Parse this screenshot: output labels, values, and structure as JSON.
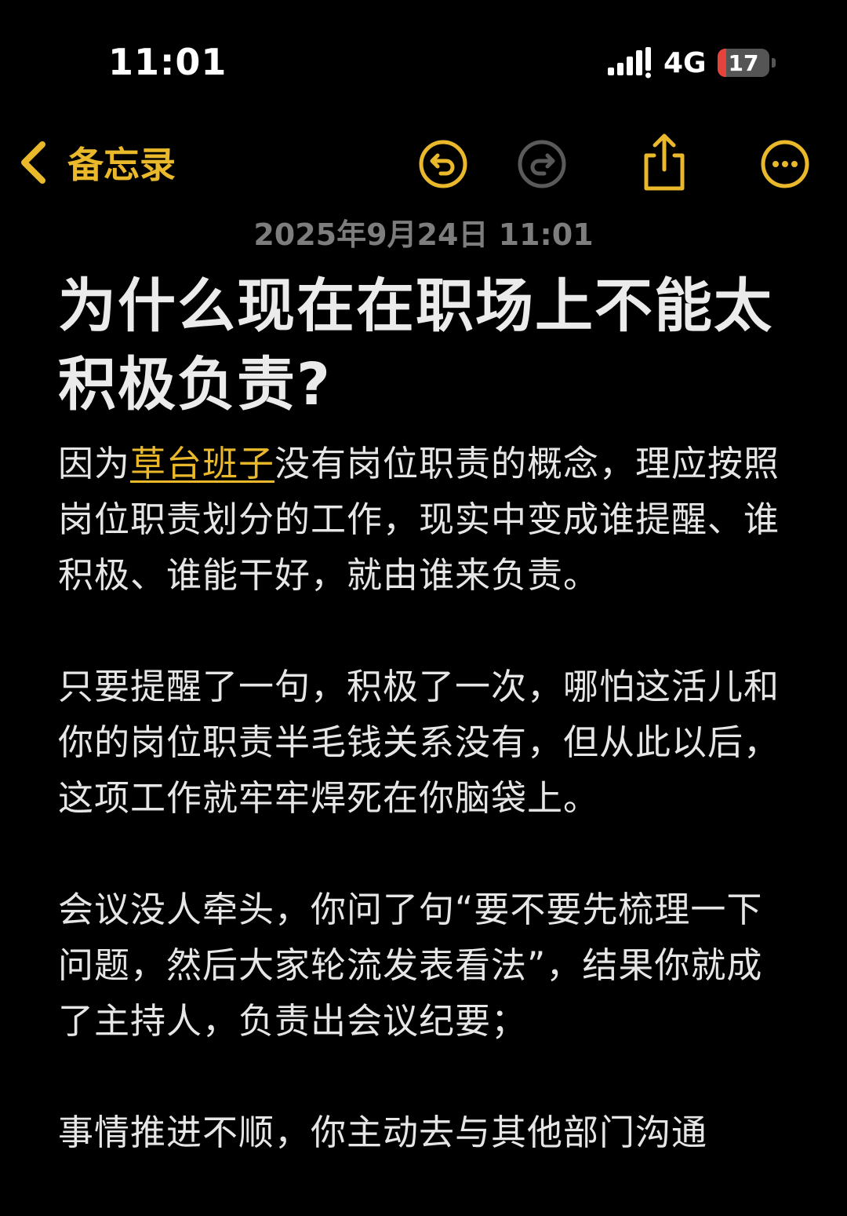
{
  "status_bar": {
    "time": "11:01",
    "network": "4G",
    "battery": "17",
    "battery_level": 0.17
  },
  "nav": {
    "back_label": "备忘录",
    "icons": [
      "undo-icon",
      "redo-icon",
      "share-icon",
      "more-icon"
    ],
    "accent_color": "#e9b92b",
    "disabled_color": "#5a5a5a"
  },
  "note": {
    "timestamp": "2025年9月24日 11:01",
    "title": "为什么现在在职场上不能太积极负责?",
    "paragraphs": [
      {
        "prefix": "因为",
        "link": "草台班子",
        "text": "没有岗位职责的概念，理应按照岗位职责划分的工作，现实中变成谁提醒、谁积极、谁能干好，就由谁来负责。"
      },
      {
        "text": "只要提醒了一句，积极了一次，哪怕这活儿和你的岗位职责半毛钱关系没有，但从此以后，这项工作就牢牢焊死在你脑袋上。"
      },
      {
        "text": "会议没人牵头，你问了句“要不要先梳理一下问题，然后大家轮流发表看法”，结果你就成了主持人，负责出会议纪要；"
      },
      {
        "text": "事情推进不顺，你主动去与其他部门沟通"
      }
    ]
  }
}
